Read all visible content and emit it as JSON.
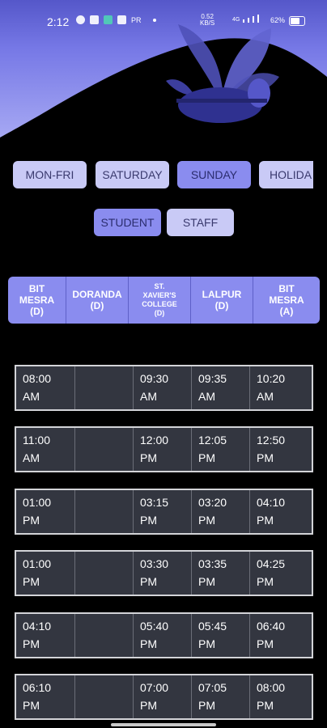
{
  "status_bar": {
    "time": "2:12",
    "carrier_badge": "PR",
    "speed_value": "0.52",
    "speed_unit": "KB/S",
    "net_label": "4G",
    "battery_pct": "62%"
  },
  "header": {
    "illustration": "plant-illustration-icon"
  },
  "day_tabs": [
    {
      "label": "MON-FRI",
      "active": false
    },
    {
      "label": "SATURDAY",
      "active": false
    },
    {
      "label": "SUNDAY",
      "active": true
    },
    {
      "label": "HOLIDA",
      "active": false
    }
  ],
  "type_tabs": [
    {
      "label": "STUDENT",
      "active": true
    },
    {
      "label": "STAFF",
      "active": false
    }
  ],
  "columns": [
    "BIT\nMESRA\n(D)",
    "DORANDA\n(D)",
    "ST.\nXAVIER'S\nCOLLEGE\n(D)",
    "LALPUR\n(D)",
    "BIT\nMESRA\n(A)"
  ],
  "rows": [
    [
      "08:00\nAM",
      "",
      "09:30\nAM",
      "09:35\nAM",
      "10:20\nAM"
    ],
    [
      "11:00\nAM",
      "",
      "12:00\nPM",
      "12:05\nPM",
      "12:50\nPM"
    ],
    [
      "01:00\nPM",
      "",
      "03:15\nPM",
      "03:20\nPM",
      "04:10\nPM"
    ],
    [
      "01:00\nPM",
      "",
      "03:30\nPM",
      "03:35\nPM",
      "04:25\nPM"
    ],
    [
      "04:10\nPM",
      "",
      "05:40\nPM",
      "05:45\nPM",
      "06:40\nPM"
    ],
    [
      "06:10\nPM",
      "",
      "07:00\nPM",
      "07:05\nPM",
      "08:00\nPM"
    ]
  ],
  "colors": {
    "header_light": "#a9abf3",
    "header_dark": "#6b6ee0",
    "chip": "#c9caf6",
    "chip_active": "#8a8cef",
    "row_bg": "#333640"
  }
}
